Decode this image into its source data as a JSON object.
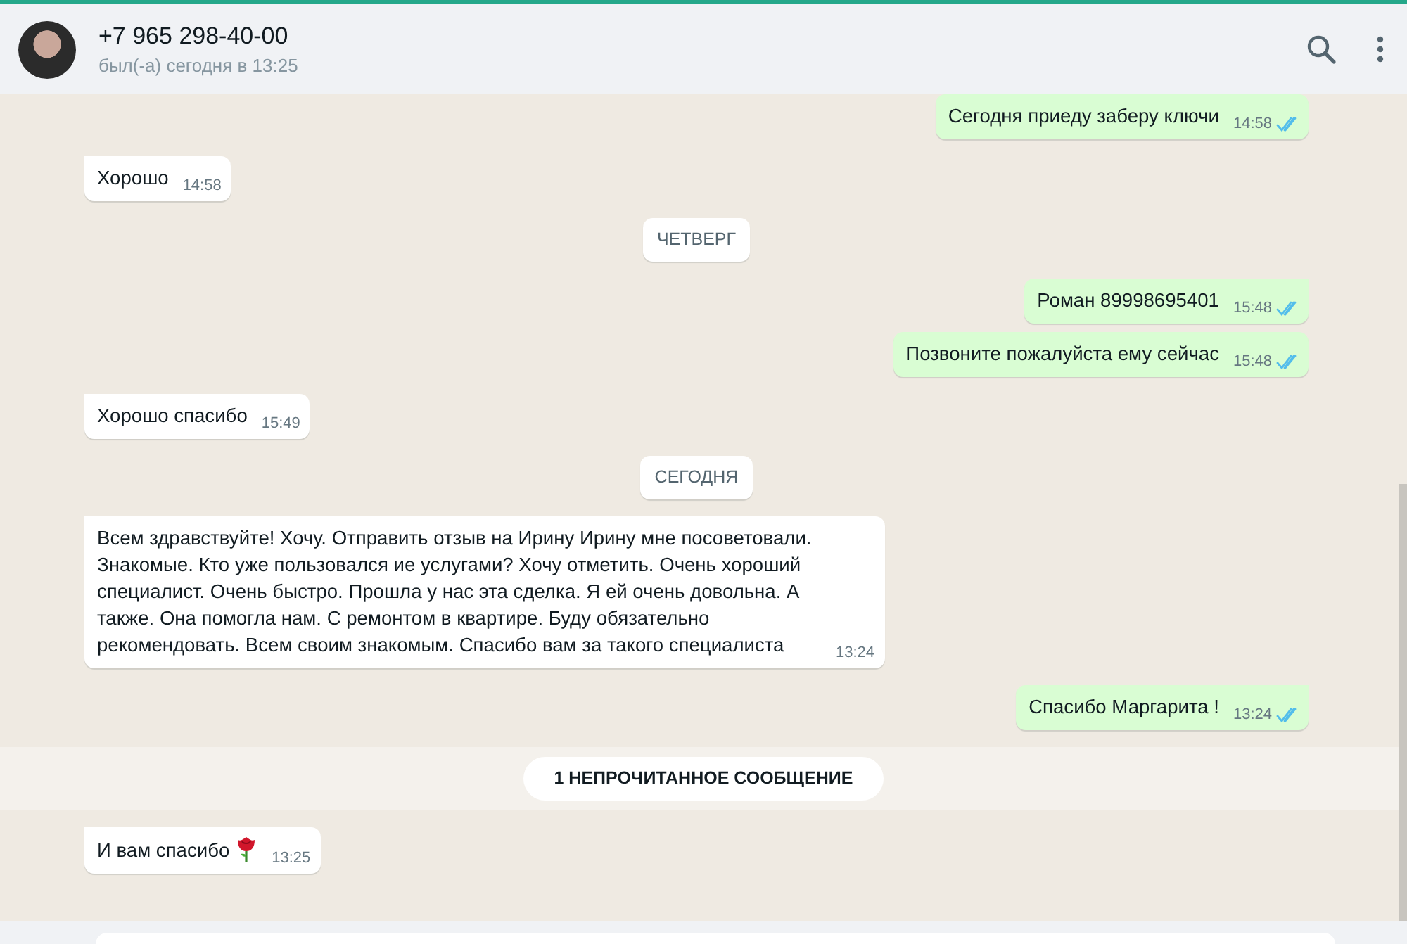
{
  "header": {
    "contact_name": "+7 965 298-40-00",
    "status": "был(-а) сегодня в 13:25"
  },
  "messages": [
    {
      "kind": "out",
      "text": "Сегодня приеду заберу ключи",
      "time": "14:58",
      "read": true,
      "tail": false
    },
    {
      "kind": "in",
      "text": "Хорошо",
      "time": "14:58",
      "tail": true
    },
    {
      "kind": "date",
      "text": "ЧЕТВЕРГ"
    },
    {
      "kind": "out",
      "text": "Роман 89998695401",
      "time": "15:48",
      "read": true,
      "tail": true
    },
    {
      "kind": "out",
      "text": "Позвоните пожалуйста ему сейчас",
      "time": "15:48",
      "read": true,
      "tail": false
    },
    {
      "kind": "in",
      "text": "Хорошо спасибо",
      "time": "15:49",
      "tail": true
    },
    {
      "kind": "date",
      "text": "СЕГОДНЯ"
    },
    {
      "kind": "in",
      "text": "Всем здравствуйте! Хочу. Отправить отзыв на Ирину Ирину мне посоветовали. Знакомые. Кто уже пользовался ие услугами? Хочу отметить. Очень хороший специалист. Очень быстро. Прошла у нас эта сделка. Я ей очень довольна. А также. Она помогла нам. С ремонтом в квартире. Буду обязательно рекомендовать. Всем своим знакомым. Спасибо вам за такого специалиста",
      "time": "13:24",
      "tail": true
    },
    {
      "kind": "out",
      "text": "Спасибо Маргарита !",
      "time": "13:24",
      "read": true,
      "tail": true
    },
    {
      "kind": "unread",
      "text": "1 НЕПРОЧИТАННОЕ СООБЩЕНИЕ"
    },
    {
      "kind": "in",
      "text": "И вам спасибо",
      "rose_emoji": true,
      "time": "13:25",
      "tail": true
    }
  ]
}
